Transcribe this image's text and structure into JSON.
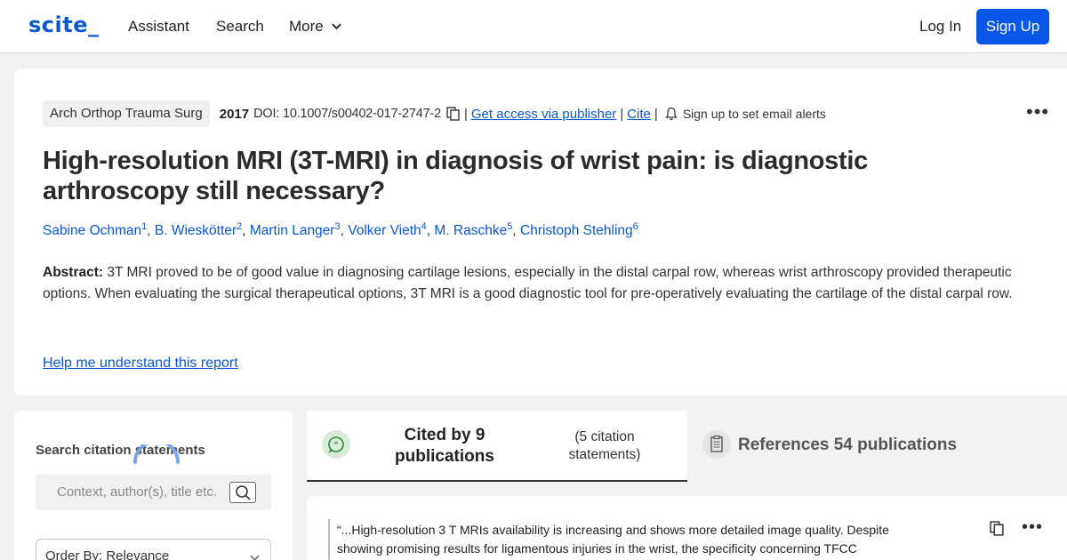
{
  "header": {
    "logo": "scite_",
    "nav": [
      "Assistant",
      "Search",
      "More"
    ],
    "login": "Log In",
    "signup": "Sign Up"
  },
  "paper": {
    "journal": "Arch Orthop Trauma Surg",
    "year": "2017",
    "doi": "DOI: 10.1007/s00402-017-2747-2",
    "access_link": "Get access via publisher",
    "cite_link": "Cite",
    "alerts": "Sign up to set email alerts",
    "title": "High-resolution MRI (3T-MRI) in diagnosis of wrist pain: is diagnostic arthroscopy still necessary?",
    "authors": [
      {
        "name": "Sabine Ochman",
        "sup": "1"
      },
      {
        "name": "B. Wieskötter",
        "sup": "2"
      },
      {
        "name": "Martin Langer",
        "sup": "3"
      },
      {
        "name": "Volker Vieth",
        "sup": "4"
      },
      {
        "name": "M. Raschke",
        "sup": "5"
      },
      {
        "name": "Christoph Stehling",
        "sup": "6"
      }
    ],
    "abstract_label": "Abstract:",
    "abstract": "3T MRI proved to be of good value in diagnosing cartilage lesions, especially in the distal carpal row, whereas wrist arthroscopy provided therapeutic options. When evaluating the surgical therapeutical options, 3T MRI is a good diagnostic tool for pre-operatively evaluating the cartilage of the distal carpal row.",
    "help_link": "Help me understand this report"
  },
  "sidebar": {
    "search_label": "Search citation statements",
    "search_placeholder": "Context, author(s), title etc.",
    "order_by": "Order By: Relevance"
  },
  "tabs": {
    "cited_title": "Cited by 9 publications",
    "cited_sub": "(5 citation statements)",
    "references": "References 54 publications"
  },
  "citation": {
    "text": "“...High-resolution 3 T MRIs availability is increasing and shows more detailed image quality. Despite showing promising results for ligamentous injuries in the wrist, the specificity concerning TFCC"
  },
  "colors": {
    "accent": "#0a56d8",
    "signup_bg": "#0a56e8",
    "cited_icon_bg": "#d8ecd9"
  }
}
